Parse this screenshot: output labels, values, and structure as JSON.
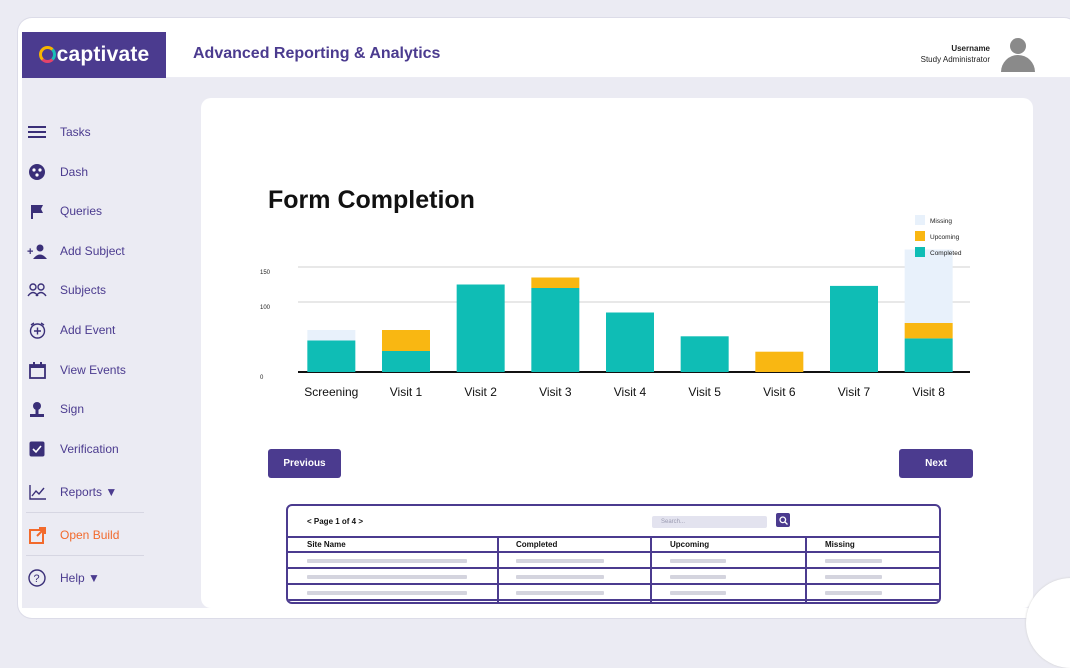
{
  "app": {
    "logo_text": "captivate",
    "title": "Advanced Reporting & Analytics"
  },
  "user": {
    "name": "Username",
    "role": "Study Administrator"
  },
  "sidebar": {
    "items": [
      {
        "label": "Tasks",
        "icon": "tasks-icon"
      },
      {
        "label": "Dash",
        "icon": "dash-icon"
      },
      {
        "label": "Queries",
        "icon": "flag-icon"
      },
      {
        "label": "Add Subject",
        "icon": "add-user-icon"
      },
      {
        "label": "Subjects",
        "icon": "users-icon"
      },
      {
        "label": "Add Event",
        "icon": "add-event-icon"
      },
      {
        "label": "View Events",
        "icon": "calendar-icon"
      },
      {
        "label": "Sign",
        "icon": "sign-icon"
      },
      {
        "label": "Verification",
        "icon": "checkbox-icon"
      },
      {
        "label": "Reports ▼",
        "icon": "line-chart-icon"
      },
      {
        "label": "Open Build",
        "icon": "external-link-icon"
      },
      {
        "label": "Help ▼",
        "icon": "help-icon"
      }
    ]
  },
  "colors": {
    "brand": "#4b3b8f",
    "missing": "#e8f1fb",
    "upcoming": "#f9b712",
    "completed": "#0fbdb5",
    "open_build": "#f26a2c"
  },
  "chart_data": {
    "type": "bar",
    "stacked": true,
    "title": "Form Completion",
    "categories": [
      "Screening",
      "Visit 1",
      "Visit 2",
      "Visit 3",
      "Visit 4",
      "Visit 5",
      "Visit 6",
      "Visit 7",
      "Visit 8"
    ],
    "series": [
      {
        "name": "Completed",
        "values": [
          45,
          30,
          125,
          120,
          85,
          51,
          0,
          123,
          48
        ]
      },
      {
        "name": "Upcoming",
        "values": [
          0,
          30,
          0,
          15,
          0,
          0,
          29,
          0,
          22
        ]
      },
      {
        "name": "Missing",
        "values": [
          15,
          0,
          0,
          0,
          0,
          0,
          0,
          0,
          105
        ]
      }
    ],
    "legend": [
      "Missing",
      "Upcoming",
      "Completed"
    ],
    "legend_position": "top-right",
    "yticks": [
      "0",
      "100",
      "150"
    ],
    "ylim": [
      0,
      150
    ],
    "grid": true
  },
  "buttons": {
    "previous": "Previous",
    "next": "Next"
  },
  "table": {
    "pager": "< Page 1 of 4 >",
    "search_placeholder": "Search...",
    "columns": [
      "Site Name",
      "Completed",
      "Upcoming",
      "Missing"
    ]
  }
}
